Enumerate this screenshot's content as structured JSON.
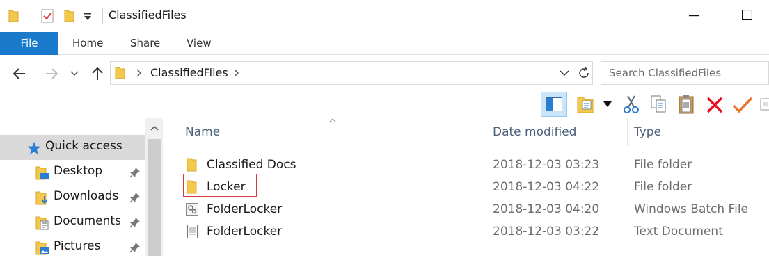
{
  "window": {
    "title": "ClassifiedFiles"
  },
  "ribbon": {
    "tabs": [
      {
        "label": "File"
      },
      {
        "label": "Home"
      },
      {
        "label": "Share"
      },
      {
        "label": "View"
      }
    ]
  },
  "address": {
    "path": [
      "ClassifiedFiles"
    ]
  },
  "search": {
    "placeholder": "Search ClassifiedFiles"
  },
  "navpane": {
    "items": [
      {
        "label": "Quick access",
        "icon": "star-icon",
        "selected": true
      },
      {
        "label": "Desktop",
        "icon": "desktop-folder-icon",
        "pinned": true
      },
      {
        "label": "Downloads",
        "icon": "downloads-folder-icon",
        "pinned": true
      },
      {
        "label": "Documents",
        "icon": "documents-folder-icon",
        "pinned": true
      },
      {
        "label": "Pictures",
        "icon": "pictures-folder-icon",
        "pinned": true
      }
    ]
  },
  "filelist": {
    "columns": {
      "name": "Name",
      "date": "Date modified",
      "type": "Type"
    },
    "rows": [
      {
        "name": "Classified Docs",
        "date": "2018-12-03 03:23",
        "type": "File folder",
        "icon": "folder-icon"
      },
      {
        "name": "Locker",
        "date": "2018-12-03 04:22",
        "type": "File folder",
        "icon": "folder-icon",
        "highlighted": true
      },
      {
        "name": "FolderLocker",
        "date": "2018-12-03 04:20",
        "type": "Windows Batch File",
        "icon": "batch-file-icon"
      },
      {
        "name": "FolderLocker",
        "date": "2018-12-03 03:22",
        "type": "Text Document",
        "icon": "text-file-icon"
      }
    ]
  },
  "colors": {
    "accent": "#1979ca",
    "folder": "#f2c94c",
    "highlight_border": "#d8383e",
    "column_header": "#4c607a",
    "delete": "#e81123",
    "check": "#e8772e"
  }
}
